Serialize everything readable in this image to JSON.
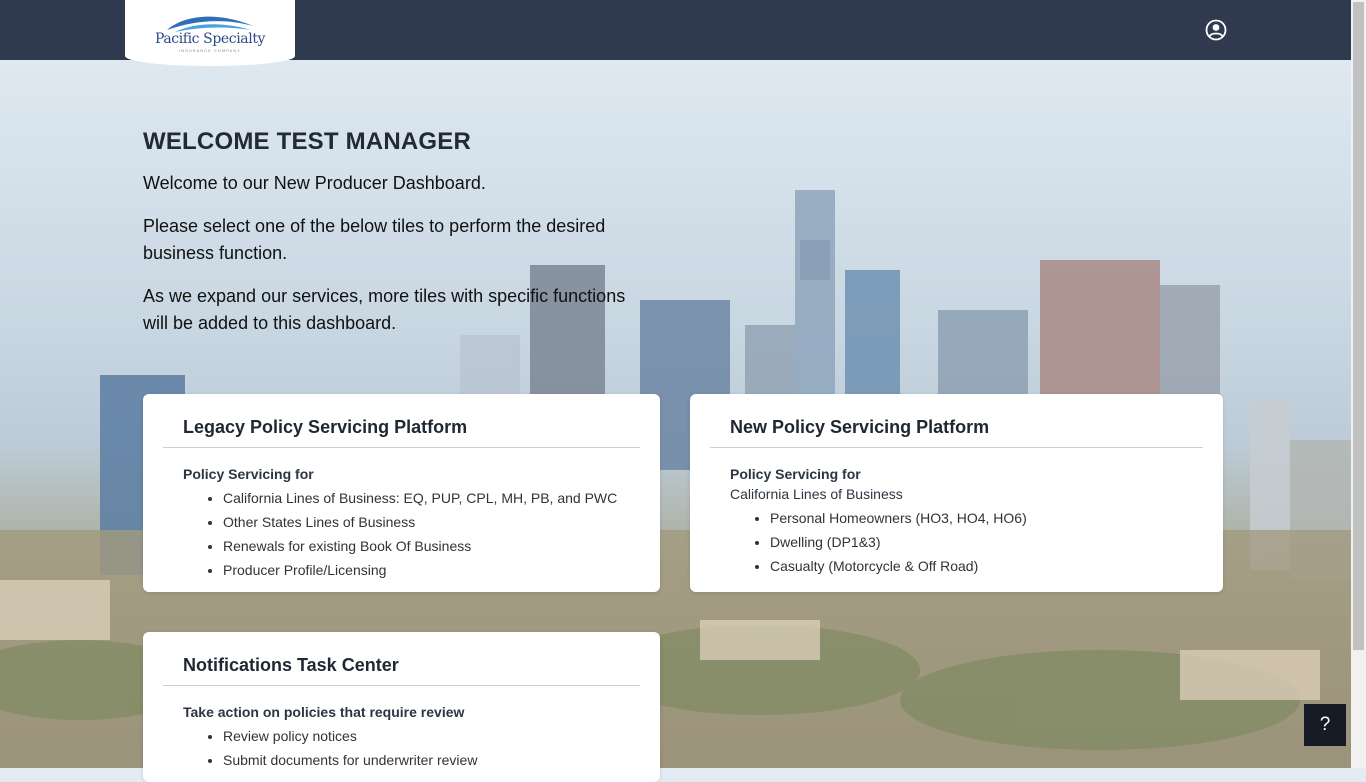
{
  "header": {
    "logo_name": "Pacific Specialty",
    "logo_tagline": "INSURANCE COMPANY",
    "user_icon": "user-circle-icon"
  },
  "welcome": {
    "title": "WELCOME TEST MANAGER",
    "line1": "Welcome to our New Producer Dashboard.",
    "line2": "Please select one of the below tiles to perform the desired business function.",
    "line3": "As we expand our services, more tiles with specific functions will be added to this dashboard."
  },
  "tiles": [
    {
      "title": "Legacy Policy Servicing Platform",
      "subtitle": "Policy Servicing for",
      "items": [
        "California Lines of Business: EQ, PUP, CPL, MH, PB, and PWC",
        "Other States Lines of Business",
        "Renewals for existing Book Of Business",
        "Producer Profile/Licensing"
      ]
    },
    {
      "title": "New Policy Servicing Platform",
      "subtitle": "Policy Servicing for",
      "subtitle2": "California Lines of Business",
      "items": [
        "Personal Homeowners (HO3, HO4, HO6)",
        "Dwelling (DP1&3)",
        "Casualty (Motorcycle & Off Road)"
      ]
    },
    {
      "title": "Notifications Task Center",
      "subtitle": "Take action on policies that require review",
      "items": [
        "Review policy notices",
        "Submit documents for underwriter review"
      ]
    }
  ],
  "help": {
    "label": "?"
  },
  "colors": {
    "topbar": "#2f3a4f",
    "tile_bg": "#ffffff",
    "help_bg": "#151c26"
  }
}
